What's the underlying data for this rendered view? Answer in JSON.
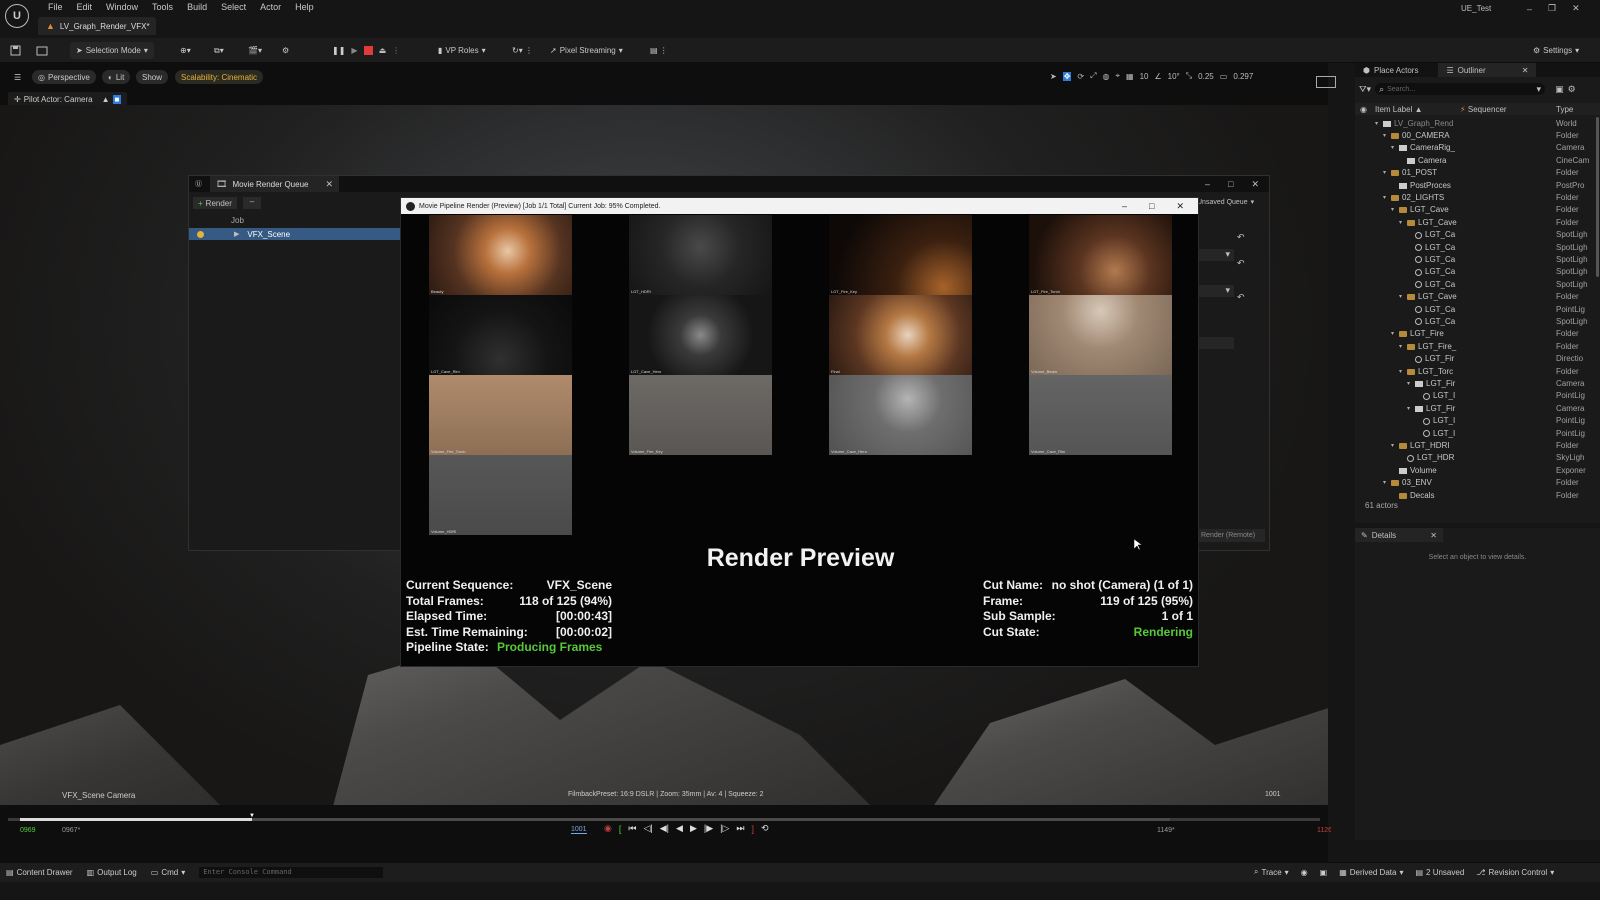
{
  "app": {
    "tab_title": "LV_Graph_Render_VFX*",
    "project": "UE_Test"
  },
  "menu": [
    "File",
    "Edit",
    "Window",
    "Tools",
    "Build",
    "Select",
    "Actor",
    "Help"
  ],
  "toolbar": {
    "selection_mode": "Selection Mode",
    "vp_roles": "VP Roles",
    "pixel_streaming": "Pixel Streaming",
    "settings": "Settings"
  },
  "viewport": {
    "perspective": "Perspective",
    "lit": "Lit",
    "show": "Show",
    "scalability": "Scalability: Cinematic",
    "pilot": "Pilot Actor: Camera",
    "snap_grid": "10",
    "snap_rot": "10°",
    "snap_scale": "0.25",
    "cam_speed": "0.297",
    "camera_label": "VFX_Scene Camera",
    "filmback": "FilmbackPreset: 16:9 DSLR | Zoom: 35mm | Av: 4 | Squeeze: 2",
    "frame_right": "1001"
  },
  "colors": {
    "accent_yellow": "#e3b33c",
    "green": "#57c83a",
    "status_red": "#c04040"
  },
  "mrq": {
    "title": "Movie Render Queue",
    "render_btn": "Render",
    "job_header": "Job",
    "job_name": "VFX_Scene",
    "unsaved": "Unsaved Queue",
    "render_remote": "Render (Remote)"
  },
  "preview": {
    "title": "Movie Pipeline Render (Preview) [Job 1/1 Total] Current Job: 95% Completed.",
    "heading": "Render Preview",
    "thumb_labels": [
      "Beauty",
      "LGT_HDRI",
      "LGT_Fire_Key",
      "LGT_Fire_Torch",
      "LGT_Cave_Rim",
      "LGT_Cave_Hero",
      "Final",
      "Volume_Beam",
      "Volume_Fire_Torch",
      "Volume_Fire_Key",
      "Volume_Cave_Hero",
      "Volume_Cave_Rim",
      "Volume_HDRI"
    ],
    "left_stats": [
      {
        "label": "Current Sequence:",
        "value": "VFX_Scene"
      },
      {
        "label": "Total Frames:",
        "value": "118 of 125 (94%)"
      },
      {
        "label": "Elapsed Time:",
        "value": "[00:00:43]"
      },
      {
        "label": "Est. Time Remaining:",
        "value": "[00:00:02]"
      },
      {
        "label": "Pipeline State:",
        "value": "Producing Frames"
      }
    ],
    "right_stats": [
      {
        "label": "Cut Name:",
        "value": "no shot (Camera) (1 of 1)"
      },
      {
        "label": "Frame:",
        "value": "119 of 125 (95%)"
      },
      {
        "label": "Sub Sample:",
        "value": "1 of 1"
      },
      {
        "label": "Cut State:",
        "value": "Rendering"
      }
    ]
  },
  "outliner": {
    "tab_place": "Place Actors",
    "tab_outliner": "Outliner",
    "search_placeholder": "Search...",
    "col_label": "Item Label",
    "col_sequencer": "Sequencer",
    "col_type": "Type",
    "actor_count": "61 actors",
    "items": [
      {
        "label": "LV_Graph_Rend",
        "type": "World",
        "indent": 0,
        "icon": "world"
      },
      {
        "label": "00_CAMERA",
        "type": "Folder",
        "indent": 1,
        "icon": "folder"
      },
      {
        "label": "CameraRig_",
        "type": "Camera",
        "indent": 2,
        "icon": "camera"
      },
      {
        "label": "Camera",
        "type": "CineCam",
        "indent": 3,
        "icon": "camera"
      },
      {
        "label": "01_POST",
        "type": "Folder",
        "indent": 1,
        "icon": "folder"
      },
      {
        "label": "PostProces",
        "type": "PostPro",
        "indent": 2,
        "icon": "camera"
      },
      {
        "label": "02_LIGHTS",
        "type": "Folder",
        "indent": 1,
        "icon": "folder"
      },
      {
        "label": "LGT_Cave",
        "type": "Folder",
        "indent": 2,
        "icon": "folder"
      },
      {
        "label": "LGT_Cave",
        "type": "Folder",
        "indent": 3,
        "icon": "folder"
      },
      {
        "label": "LGT_Ca",
        "type": "SpotLigh",
        "indent": 4,
        "icon": "light"
      },
      {
        "label": "LGT_Ca",
        "type": "SpotLigh",
        "indent": 4,
        "icon": "light"
      },
      {
        "label": "LGT_Ca",
        "type": "SpotLigh",
        "indent": 4,
        "icon": "light"
      },
      {
        "label": "LGT_Ca",
        "type": "SpotLigh",
        "indent": 4,
        "icon": "light"
      },
      {
        "label": "LGT_Ca",
        "type": "SpotLigh",
        "indent": 4,
        "icon": "light"
      },
      {
        "label": "LGT_Cave",
        "type": "Folder",
        "indent": 3,
        "icon": "folder"
      },
      {
        "label": "LGT_Ca",
        "type": "PointLig",
        "indent": 4,
        "icon": "light"
      },
      {
        "label": "LGT_Ca",
        "type": "SpotLigh",
        "indent": 4,
        "icon": "light"
      },
      {
        "label": "LGT_Fire",
        "type": "Folder",
        "indent": 2,
        "icon": "folder"
      },
      {
        "label": "LGT_Fire_",
        "type": "Folder",
        "indent": 3,
        "icon": "folder"
      },
      {
        "label": "LGT_Fir",
        "type": "Directio",
        "indent": 4,
        "icon": "light"
      },
      {
        "label": "LGT_Torc",
        "type": "Folder",
        "indent": 3,
        "icon": "folder"
      },
      {
        "label": "LGT_Fir",
        "type": "Camera",
        "indent": 4,
        "icon": "camera"
      },
      {
        "label": "LGT_I",
        "type": "PointLig",
        "indent": 5,
        "icon": "light"
      },
      {
        "label": "LGT_Fir",
        "type": "Camera",
        "indent": 4,
        "icon": "camera"
      },
      {
        "label": "LGT_I",
        "type": "PointLig",
        "indent": 5,
        "icon": "light"
      },
      {
        "label": "LGT_I",
        "type": "PointLig",
        "indent": 5,
        "icon": "light"
      },
      {
        "label": "LGT_HDRI",
        "type": "Folder",
        "indent": 2,
        "icon": "folder"
      },
      {
        "label": "LGT_HDR",
        "type": "SkyLigh",
        "indent": 3,
        "icon": "light"
      },
      {
        "label": "Volume",
        "type": "Exponer",
        "indent": 2,
        "icon": "camera"
      },
      {
        "label": "03_ENV",
        "type": "Folder",
        "indent": 1,
        "icon": "folder"
      },
      {
        "label": "Decals",
        "type": "Folder",
        "indent": 2,
        "icon": "folder"
      }
    ]
  },
  "details": {
    "tab": "Details",
    "empty": "Select an object to view details."
  },
  "timeline": {
    "start_green": "0969",
    "start": "0967*",
    "current": "1001",
    "end": "1149*",
    "end_red": "1126"
  },
  "status": {
    "content_drawer": "Content Drawer",
    "output_log": "Output Log",
    "cmd": "Cmd",
    "console_placeholder": "Enter Console Command",
    "trace": "Trace",
    "derived_data": "Derived Data",
    "unsaved": "2 Unsaved",
    "revision": "Revision Control"
  }
}
